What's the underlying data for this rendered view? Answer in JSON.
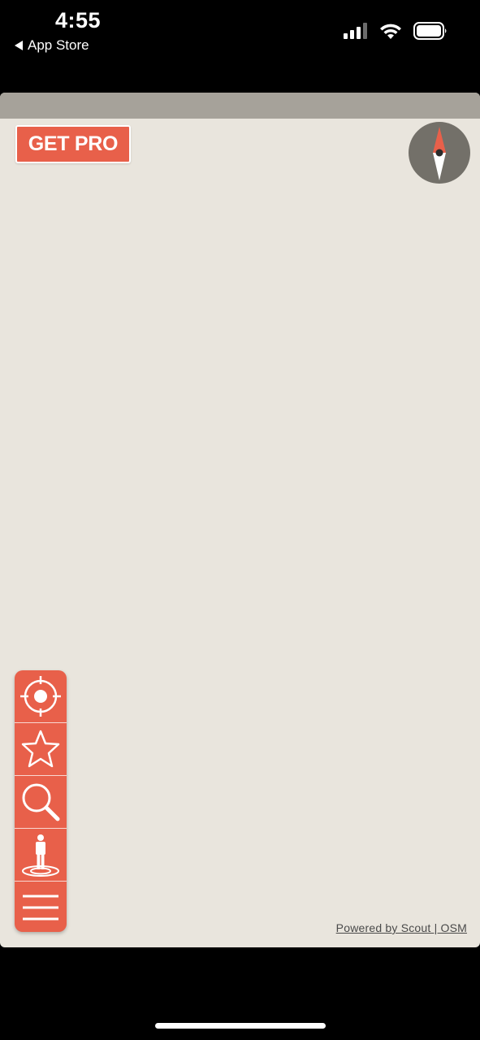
{
  "status_bar": {
    "time": "4:55",
    "back_label": "App Store",
    "icons": [
      "signal-icon",
      "wifi-icon",
      "battery-icon"
    ]
  },
  "map": {
    "get_pro_label": "GET PRO",
    "attribution": "Powered by Scout | OSM",
    "colors": {
      "accent": "#e8604a",
      "map_background": "#e9e5dd",
      "top_strip": "#a6a29a",
      "compass_bg": "#737069"
    }
  },
  "toolbar": {
    "items": [
      {
        "icon": "locate-target-icon"
      },
      {
        "icon": "star-icon"
      },
      {
        "icon": "search-icon"
      },
      {
        "icon": "person-location-icon"
      },
      {
        "icon": "menu-icon"
      }
    ]
  }
}
